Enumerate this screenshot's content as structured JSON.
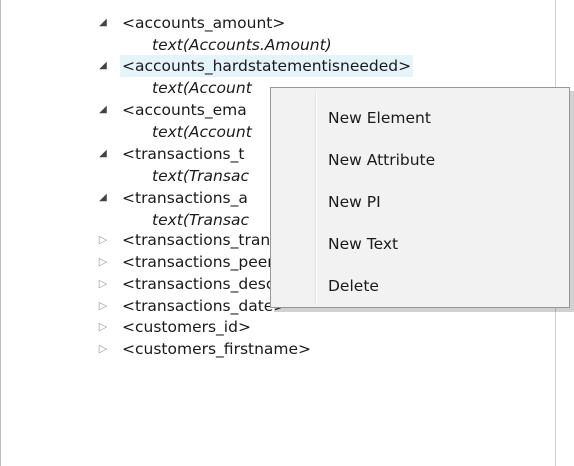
{
  "tree": {
    "nodes": [
      {
        "label": "<accounts_amount>",
        "kind": "element",
        "state": "expanded"
      },
      {
        "label": "text(Accounts.Amount)",
        "kind": "text"
      },
      {
        "label": "<accounts_hardstatementisneeded>",
        "kind": "element",
        "state": "expanded",
        "selected": true
      },
      {
        "label": "text(Account",
        "kind": "text"
      },
      {
        "label": "<accounts_ema",
        "kind": "element",
        "state": "expanded"
      },
      {
        "label": "text(Account",
        "kind": "text"
      },
      {
        "label": "<transactions_t",
        "kind": "element",
        "state": "expanded"
      },
      {
        "label": "text(Transac",
        "kind": "text"
      },
      {
        "label": "<transactions_a",
        "kind": "element",
        "state": "expanded"
      },
      {
        "label": "text(Transac",
        "kind": "text"
      },
      {
        "label": "<transactions_transamount>",
        "kind": "element",
        "state": "collapsed"
      },
      {
        "label": "<transactions_peer>",
        "kind": "element",
        "state": "collapsed"
      },
      {
        "label": "<transactions_description>",
        "kind": "element",
        "state": "collapsed"
      },
      {
        "label": "<transactions_date>",
        "kind": "element",
        "state": "collapsed"
      },
      {
        "label": "<customers_id>",
        "kind": "element",
        "state": "collapsed"
      },
      {
        "label": "<customers_firstname>",
        "kind": "element",
        "state": "collapsed"
      }
    ],
    "expanded_arrow": "◢",
    "collapsed_arrow": "▷"
  },
  "context_menu": {
    "items": [
      {
        "label": "New Element"
      },
      {
        "label": "New Attribute"
      },
      {
        "label": "New PI"
      },
      {
        "label": "New Text"
      },
      {
        "label": "Delete"
      }
    ]
  }
}
